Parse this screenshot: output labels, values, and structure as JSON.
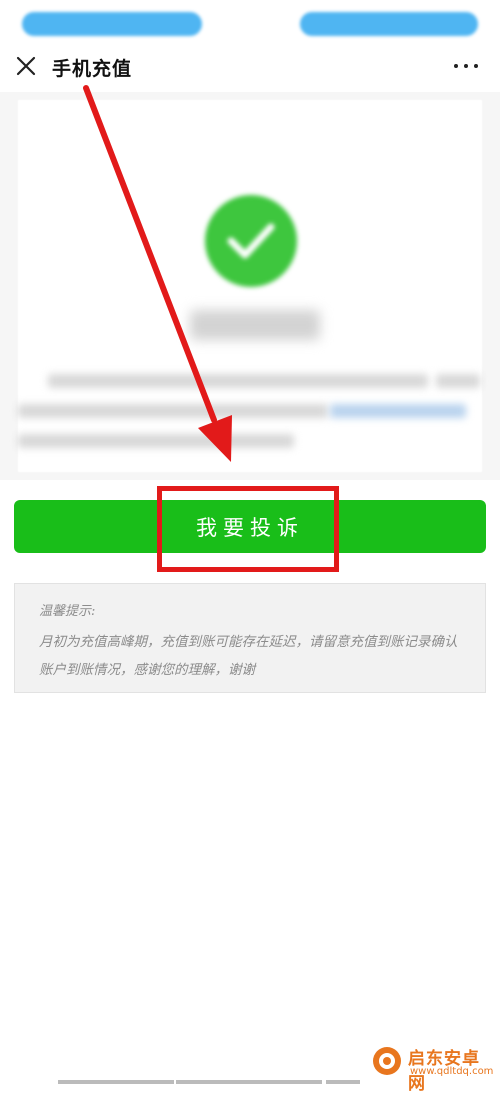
{
  "header": {
    "title": "手机充值",
    "close_icon": "close-icon",
    "more_icon": "more-icon"
  },
  "main": {
    "complain_label": "我要投诉",
    "tips_title": "温馨提示:",
    "tips_text": "月初为充值高峰期，充值到账可能存在延迟，请留意充值到账记录确认账户到账情况，感谢您的理解，谢谢"
  },
  "watermark": {
    "name": "启东安卓网",
    "url": "www.qdltdq.com"
  },
  "colors": {
    "primary_green": "#19be19",
    "annotation_red": "#e21a1a",
    "watermark_orange": "#e8761e"
  }
}
